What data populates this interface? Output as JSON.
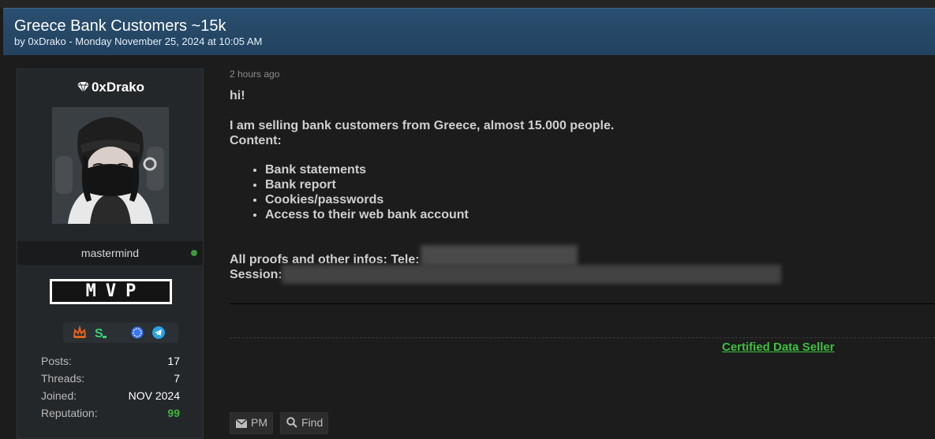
{
  "thread": {
    "title": "Greece Bank Customers ~15k",
    "byline": "by 0xDrako - Monday November 25, 2024 at 10:05 AM"
  },
  "user": {
    "name": "0xDrako",
    "title": "mastermind",
    "badge": "MVP",
    "status_color": "#3a9a3a",
    "icons": [
      "crown-icon",
      "s-logo-icon",
      "signal-icon",
      "telegram-icon"
    ],
    "stats": [
      {
        "label": "Posts:",
        "value": "17"
      },
      {
        "label": "Threads:",
        "value": "7"
      },
      {
        "label": "Joined:",
        "value": "NOV 2024"
      },
      {
        "label": "Reputation:",
        "value": "99"
      }
    ]
  },
  "post": {
    "timestamp": "2 hours ago",
    "greeting": "hi!",
    "line1": "I am selling bank customers from Greece, almost 15.000 people.",
    "line2": "Content:",
    "items": [
      "Bank statements",
      "Bank report",
      "Cookies/passwords",
      "Access to their web bank account"
    ],
    "proofs_label": "All proofs and other infos: Tele:",
    "session_label": "Session:"
  },
  "signature": {
    "text": "Certified Data Seller"
  },
  "actions": {
    "pm_label": "PM",
    "find_label": "Find"
  },
  "colors": {
    "header_bg": "#2a4f70",
    "accent_green": "#3fbf3f",
    "reputation": "#3cb83c"
  }
}
